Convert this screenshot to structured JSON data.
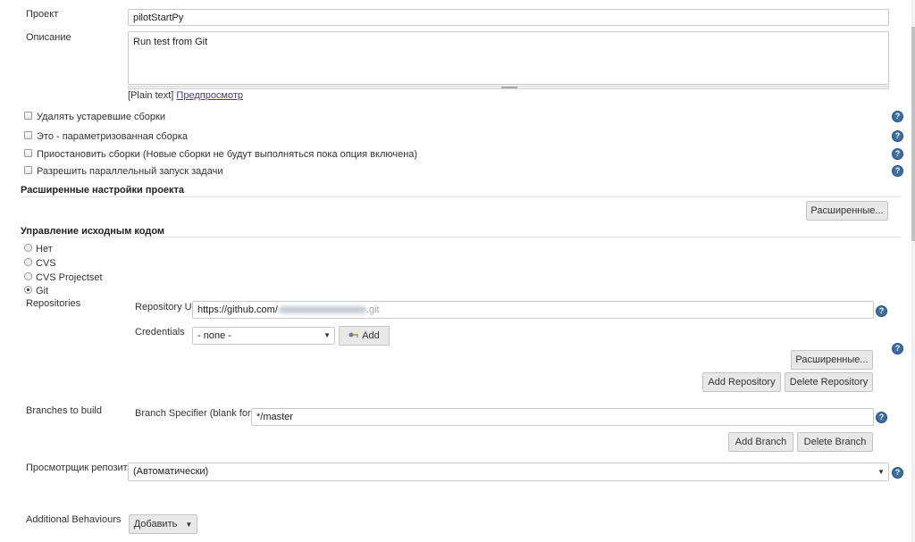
{
  "project": {
    "label": "Проект",
    "value": "pilotStartPy"
  },
  "description": {
    "label": "Описание",
    "value": "Run test from Git",
    "format_text": "[Plain text]",
    "preview_link": "Предпросмотр"
  },
  "options": [
    {
      "label": "Удалять устаревшие сборки",
      "checked": false
    },
    {
      "label": "Это - параметризованная сборка",
      "checked": false
    },
    {
      "label": "Приостановить сборки (Новые сборки не будут выполняться пока опция включена)",
      "checked": false
    },
    {
      "label": "Разрешить параллельный запуск задачи",
      "checked": false
    }
  ],
  "advanced_project": {
    "heading": "Расширенные настройки проекта",
    "button": "Расширенные..."
  },
  "scm": {
    "heading": "Управление исходным кодом",
    "choices": [
      {
        "label": "Нет",
        "selected": false
      },
      {
        "label": "CVS",
        "selected": false
      },
      {
        "label": "CVS Projectset",
        "selected": false
      },
      {
        "label": "Git",
        "selected": true
      }
    ],
    "repositories_label": "Repositories",
    "repo_url_label": "Repository URL",
    "repo_url_value": "https://github.com/",
    "repo_url_suffix": ".git",
    "credentials_label": "Credentials",
    "credentials_value": "- none -",
    "add_button": "Add",
    "advanced_button": "Расширенные...",
    "add_repository": "Add Repository",
    "delete_repository": "Delete Repository",
    "branches_label": "Branches to build",
    "branch_specifier_label": "Branch Specifier (blank for 'any')",
    "branch_specifier_value": "*/master",
    "add_branch": "Add Branch",
    "delete_branch": "Delete Branch",
    "browser_label": "Просмотрщик репозитория",
    "browser_value": "(Автоматически)",
    "behaviours_label": "Additional Behaviours",
    "behaviours_button": "Добавить"
  },
  "icons": {
    "help": "help-icon",
    "key": "key-icon",
    "caret": "caret-down-icon"
  },
  "colors": {
    "help": "#3a6ea5",
    "button": "#e8e8e8",
    "link": "#4b3a7a"
  }
}
